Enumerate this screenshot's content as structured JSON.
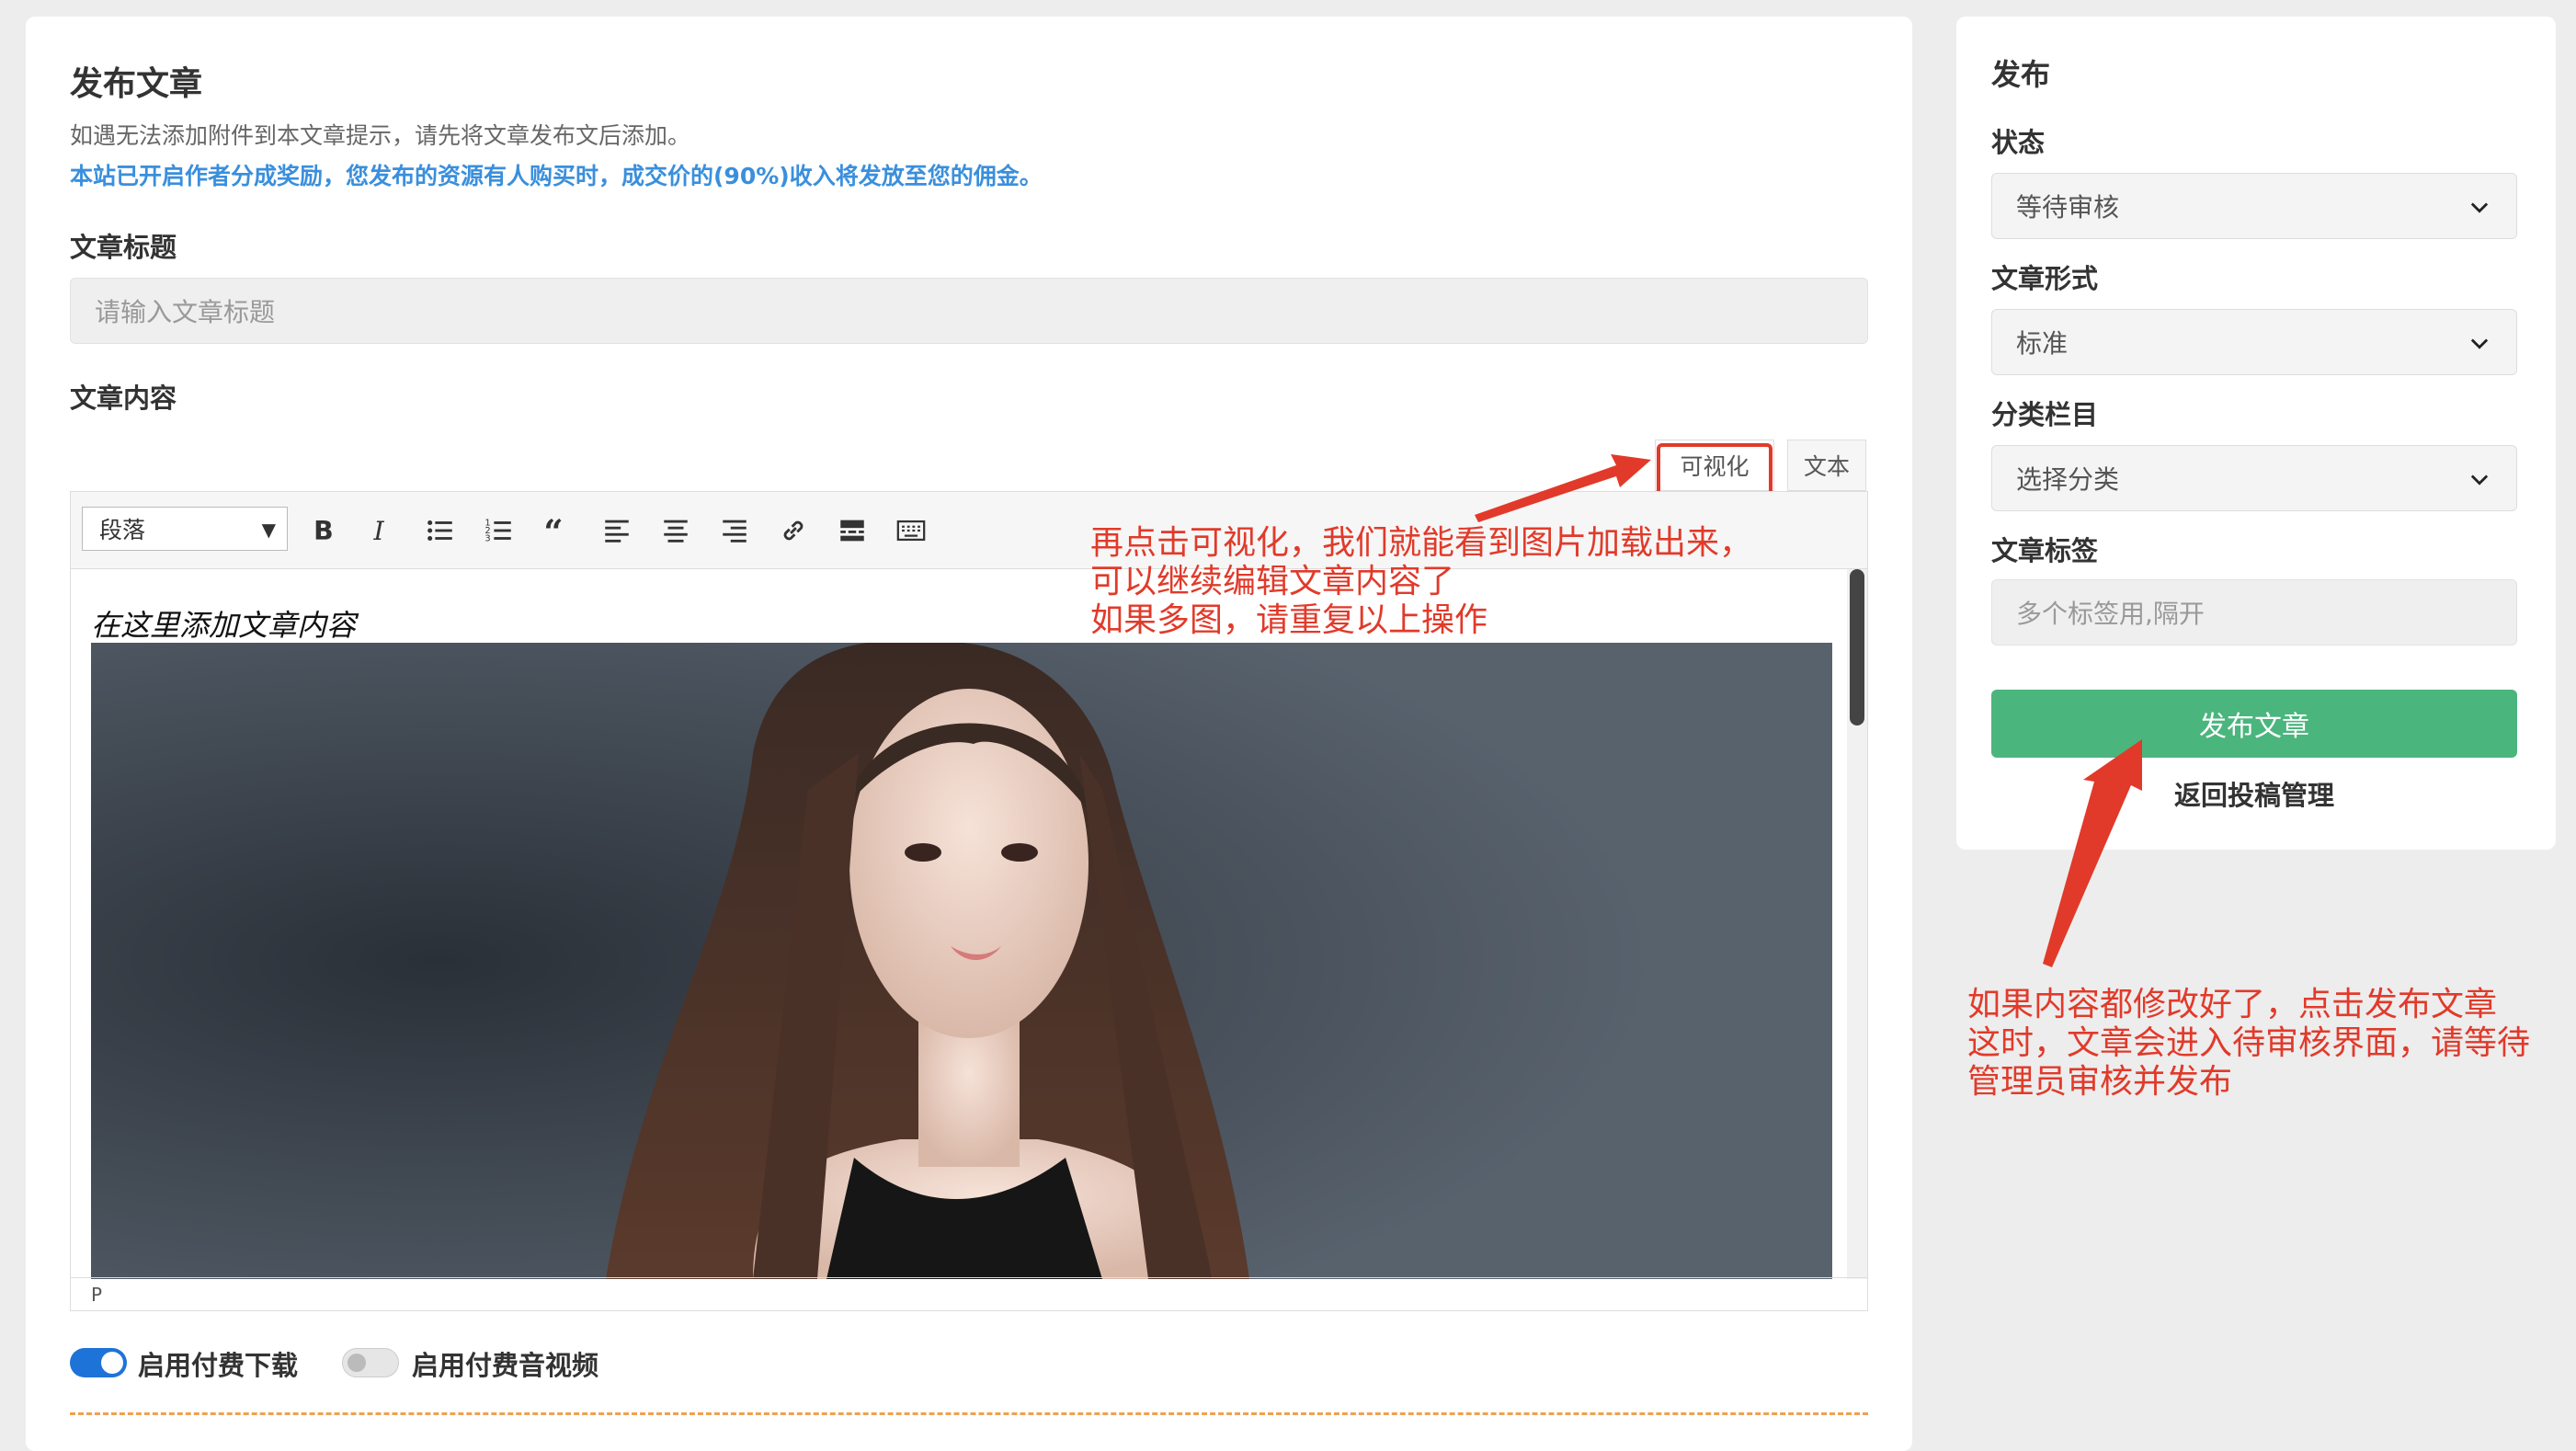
{
  "main": {
    "title": "发布文章",
    "notice": "如遇无法添加附件到本文章提示，请先将文章发布文后添加。",
    "notice_highlight": "本站已开启作者分成奖励，您发布的资源有人购买时，成交价的(90%)收入将发放至您的佣金。",
    "title_label": "文章标题",
    "title_placeholder": "请输入文章标题",
    "content_label": "文章内容"
  },
  "editor": {
    "tabs": [
      "可视化",
      "文本"
    ],
    "format_select": "段落",
    "toolbar_icons": [
      "bold-icon",
      "italic-icon",
      "bulleted-list-icon",
      "numbered-list-icon",
      "blockquote-icon",
      "align-left-icon",
      "align-center-icon",
      "align-right-icon",
      "link-icon",
      "read-more-icon",
      "toolbar-toggle-icon"
    ],
    "placeholder": "在这里添加文章内容",
    "status_path": "P"
  },
  "toggles": [
    {
      "label": "启用付费下载",
      "on": true
    },
    {
      "label": "启用付费音视频",
      "on": false
    }
  ],
  "sidebar": {
    "title": "发布",
    "status_label": "状态",
    "status_value": "等待审核",
    "format_label": "文章形式",
    "format_value": "标准",
    "category_label": "分类栏目",
    "category_value": "选择分类",
    "tags_label": "文章标签",
    "tags_placeholder": "多个标签用,隔开",
    "publish_button": "发布文章",
    "back_link": "返回投稿管理"
  },
  "annotations": {
    "editor_note": [
      "再点击可视化，我们就能看到图片加载出来，",
      "可以继续编辑文章内容了",
      "如果多图，请重复以上操作"
    ],
    "publish_note": [
      "如果内容都修改好了，点击发布文章",
      "这时，文章会进入待审核界面，请等待",
      "管理员审核并发布"
    ]
  },
  "colors": {
    "accent_blue": "#3a8fdc",
    "publish_green": "#4bb57e",
    "annotation_red": "#e13a2a",
    "toggle_on": "#1e73d8"
  }
}
